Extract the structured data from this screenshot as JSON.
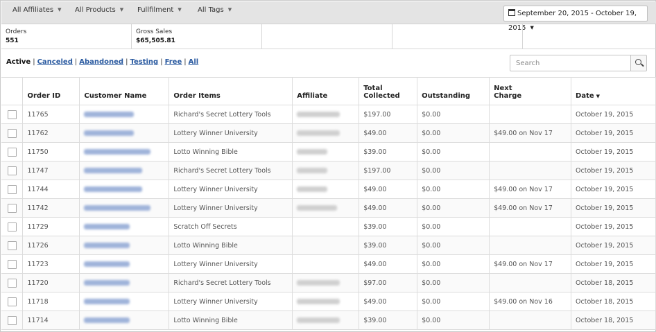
{
  "filters": {
    "affiliates": "All Affiliates",
    "products": "All Products",
    "fulfillment": "Fullfilment",
    "tags": "All Tags",
    "date_range": "September 20, 2015 - October 19, 2015"
  },
  "stats": {
    "orders_label": "Orders",
    "orders_value": "551",
    "gross_label": "Gross Sales",
    "gross_value": "$65,505.81"
  },
  "tabs": {
    "active": "Active",
    "canceled": "Canceled",
    "abandoned": "Abandoned",
    "testing": "Testing",
    "free": "Free",
    "all": "All"
  },
  "search": {
    "placeholder": "Search"
  },
  "columns": {
    "order_id": "Order ID",
    "customer": "Customer Name",
    "items": "Order Items",
    "affiliate": "Affiliate",
    "collected_1": "Total",
    "collected_2": "Collected",
    "outstanding": "Outstanding",
    "next_1": "Next",
    "next_2": "Charge",
    "date": "Date"
  },
  "rows": [
    {
      "id": "11765",
      "item": "Richard's Secret Lottery Tools",
      "collected": "$197.00",
      "outstanding": "$0.00",
      "next": "",
      "date": "October 19, 2015"
    },
    {
      "id": "11762",
      "item": "Lottery Winner University",
      "collected": "$49.00",
      "outstanding": "$0.00",
      "next": "$49.00 on Nov 17",
      "date": "October 19, 2015"
    },
    {
      "id": "11750",
      "item": "Lotto Winning Bible",
      "collected": "$39.00",
      "outstanding": "$0.00",
      "next": "",
      "date": "October 19, 2015"
    },
    {
      "id": "11747",
      "item": "Richard's Secret Lottery Tools",
      "collected": "$197.00",
      "outstanding": "$0.00",
      "next": "",
      "date": "October 19, 2015"
    },
    {
      "id": "11744",
      "item": "Lottery Winner University",
      "collected": "$49.00",
      "outstanding": "$0.00",
      "next": "$49.00 on Nov 17",
      "date": "October 19, 2015"
    },
    {
      "id": "11742",
      "item": "Lottery Winner University",
      "collected": "$49.00",
      "outstanding": "$0.00",
      "next": "$49.00 on Nov 17",
      "date": "October 19, 2015"
    },
    {
      "id": "11729",
      "item": "Scratch Off Secrets",
      "collected": "$39.00",
      "outstanding": "$0.00",
      "next": "",
      "date": "October 19, 2015"
    },
    {
      "id": "11726",
      "item": "Lotto Winning Bible",
      "collected": "$39.00",
      "outstanding": "$0.00",
      "next": "",
      "date": "October 19, 2015"
    },
    {
      "id": "11723",
      "item": "Lottery Winner University",
      "collected": "$49.00",
      "outstanding": "$0.00",
      "next": "$49.00 on Nov 17",
      "date": "October 19, 2015"
    },
    {
      "id": "11720",
      "item": "Richard's Secret Lottery Tools",
      "collected": "$97.00",
      "outstanding": "$0.00",
      "next": "",
      "date": "October 18, 2015"
    },
    {
      "id": "11718",
      "item": "Lottery Winner University",
      "collected": "$49.00",
      "outstanding": "$0.00",
      "next": "$49.00 on Nov 16",
      "date": "October 18, 2015"
    },
    {
      "id": "11714",
      "item": "Lotto Winning Bible",
      "collected": "$39.00",
      "outstanding": "$0.00",
      "next": "",
      "date": "October 18, 2015"
    }
  ]
}
